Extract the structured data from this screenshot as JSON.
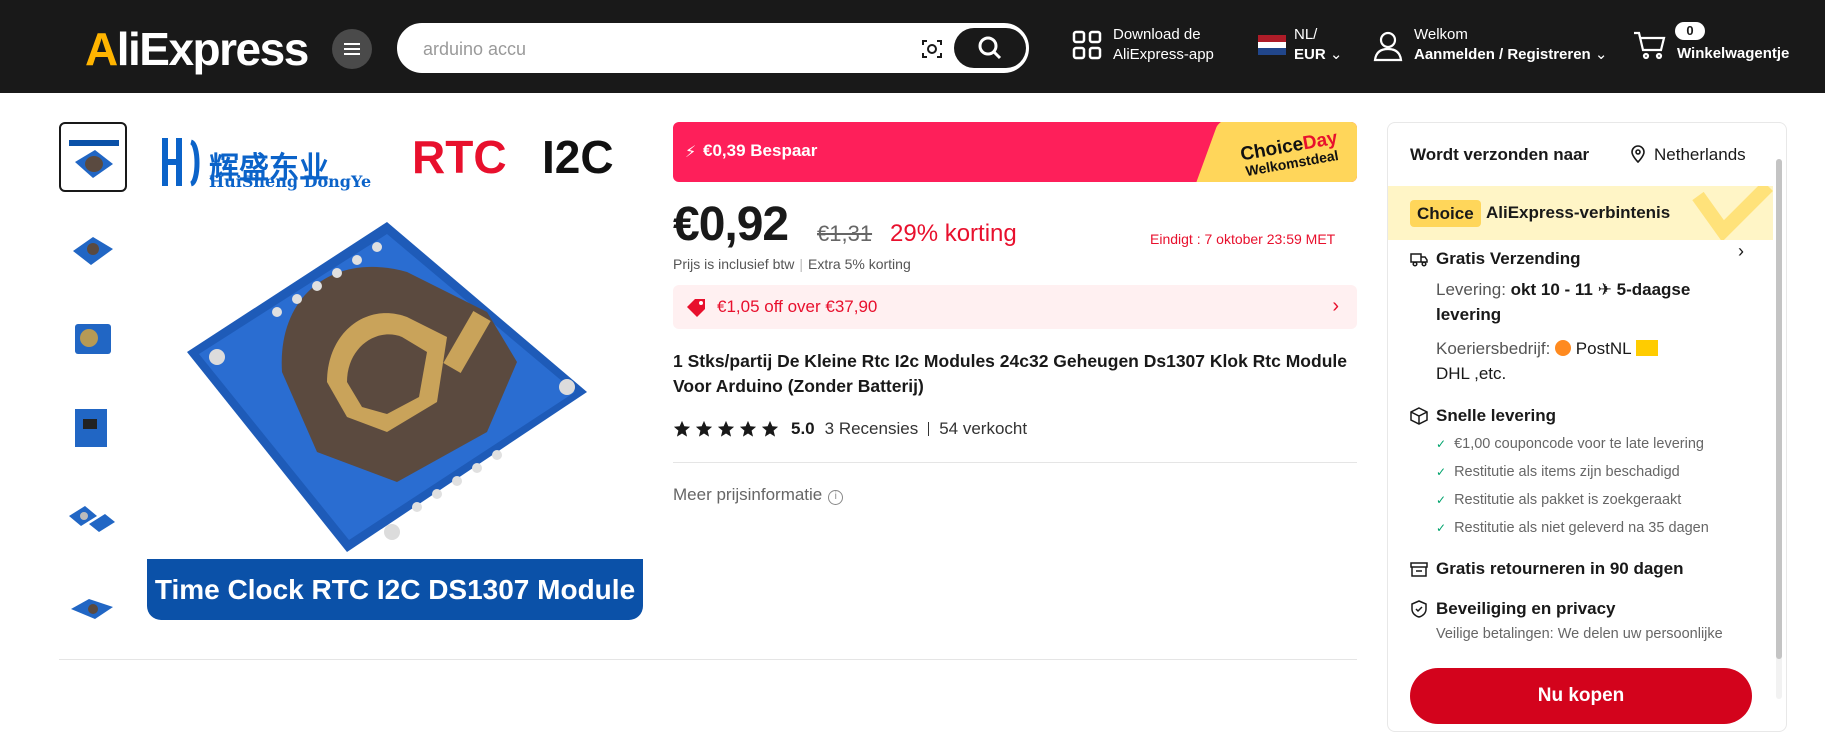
{
  "header": {
    "logo": "AliExpress",
    "search_value": "arduino accu",
    "download_line1": "Download de",
    "download_line2": "AliExpress-app",
    "lang_line1": "NL/",
    "lang_line2": "EUR",
    "welcome": "Welkom",
    "signin": "Aanmelden / Registreren",
    "cart_label": "Winkelwagentje",
    "cart_count": "0"
  },
  "gallery": {
    "brand_cn": "辉盛东业",
    "brand_en": "HuiSheng DongYe",
    "rtc": "RTC",
    "i2c": "I2C",
    "banner": "Time Clock RTC I2C DS1307 Module",
    "thumb_count": 6
  },
  "promo": {
    "save_text": "€0,39 Bespaar",
    "choiceday_1": "Choice",
    "choiceday_2": "Day",
    "choiceday_sub": "Welkomstdeal"
  },
  "price": {
    "current": "€0,92",
    "original": "€1,31",
    "discount": "29% korting",
    "ends": "Eindigt :  7 oktober 23:59 MET",
    "vat_note": "Prijs is inclusief btw",
    "extra": "Extra 5% korting"
  },
  "coupon": {
    "text": "€1,05 off over €37,90"
  },
  "product": {
    "title": "1 Stks/partij De Kleine Rtc I2c Modules 24c32 Geheugen Ds1307 Klok Rtc Module Voor Arduino (Zonder Batterij)",
    "rating": "5.0",
    "rating_value": 5,
    "reviews": "3 Recensies",
    "sold": "54 verkocht",
    "more_price": "Meer prijsinformatie"
  },
  "panel": {
    "ship_to": "Wordt verzonden naar",
    "country": "Netherlands",
    "choice_badge": "Choice",
    "choice_commitment": "AliExpress-verbintenis",
    "free_shipping": "Gratis Verzending",
    "delivery_label": "Levering:",
    "delivery_dates": "okt 10 - 11",
    "delivery_days": "5-daagse",
    "delivery_word": "levering",
    "courier_label": "Koeriersbedrijf:",
    "courier_1": "PostNL",
    "courier_2": "DHL ,etc.",
    "fast_delivery": "Snelle levering",
    "fast_items": [
      "€1,00 couponcode voor te late levering",
      "Restitutie als items zijn beschadigd",
      "Restitutie als pakket is zoekgeraakt",
      "Restitutie als niet geleverd na 35 dagen"
    ],
    "returns": "Gratis retourneren in 90 dagen",
    "security": "Beveiliging en privacy",
    "security_text": "Veilige betalingen: We delen uw persoonlijke",
    "buy_now": "Nu kopen"
  },
  "colors": {
    "header_bg": "#191919",
    "promo_red": "#fe1f5a",
    "discount_red": "#e8102d",
    "buy_red": "#d3031c",
    "choice_yellow": "#ffd65a",
    "check_green": "#00a36c"
  }
}
